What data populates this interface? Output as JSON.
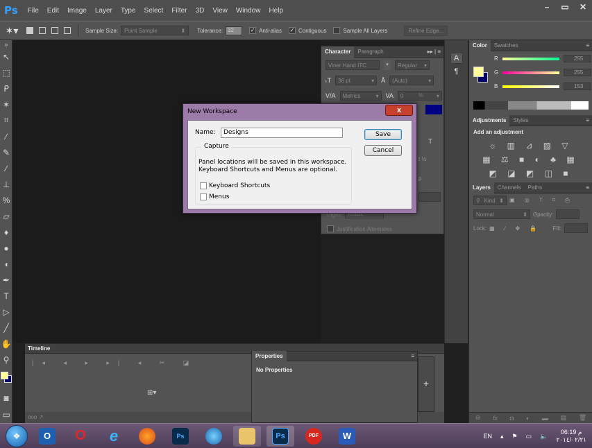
{
  "app": {
    "logo": "Ps",
    "menu": [
      "File",
      "Edit",
      "Image",
      "Layer",
      "Type",
      "Select",
      "Filter",
      "3D",
      "View",
      "Window",
      "Help"
    ],
    "window_buttons": [
      "–",
      "▭",
      "✕"
    ]
  },
  "options_bar": {
    "sample_size_label": "Sample Size:",
    "sample_size_value": "Point Sample",
    "tolerance_label": "Tolerance:",
    "tolerance_value": "32",
    "anti_alias": "Anti-alias",
    "contiguous": "Contiguous",
    "sample_all_layers": "Sample All Layers",
    "refine_edge": "Refine Edge..."
  },
  "character_panel": {
    "tabs": [
      "Character",
      "Paragraph"
    ],
    "font_family": "Viner Hand ITC",
    "font_style": "Regular",
    "font_size": "36 pt",
    "leading": "(Auto)",
    "kerning": "Metrics",
    "tracking": "0",
    "percent_frag": "%",
    "digits_label": "Digits:",
    "digits_value": "Arabic",
    "justification_alternates": "Justification Alternates",
    "frac_t": "T",
    "frac_half": "t ½",
    "frac_p": "p"
  },
  "color_panel": {
    "tabs": [
      "Color",
      "Swatches"
    ],
    "r_label": "R",
    "r_value": "255",
    "g_label": "G",
    "g_value": "255",
    "b_label": "B",
    "b_value": "153",
    "fg_color": "#ffff99",
    "bg_color": "#000066"
  },
  "adjustments_panel": {
    "tabs": [
      "Adjustments",
      "Styles"
    ],
    "heading": "Add an adjustment"
  },
  "layers_panel": {
    "tabs": [
      "Layers",
      "Channels",
      "Paths"
    ],
    "kind_label": "Kind",
    "blend_mode": "Normal",
    "opacity_label": "Opacity:",
    "lock_label": "Lock:",
    "fill_label": "Fill:"
  },
  "timeline": {
    "tab": "Timeline",
    "footer": "ooo"
  },
  "properties_panel": {
    "tab": "Properties",
    "empty_text": "No Properties"
  },
  "dialog": {
    "title": "New Workspace",
    "name_label": "Name:",
    "name_value": "Designs",
    "capture_legend": "Capture",
    "capture_text": "Panel locations will be saved in this workspace. Keyboard Shortcuts and Menus are optional.",
    "keyboard_shortcuts_label": "Keyboard Shortcuts",
    "menus_label": "Menus",
    "save_label": "Save",
    "cancel_label": "Cancel",
    "close_glyph": "x"
  },
  "taskbar": {
    "lang": "EN",
    "time": "06:19 م",
    "date": "٢٠١٤/٠٢/٢١",
    "apps": [
      "outlook",
      "opera",
      "internet-explorer",
      "firefox",
      "photoshop",
      "app-blue",
      "file-explorer",
      "photoshop-active",
      "pdf",
      "word"
    ]
  }
}
